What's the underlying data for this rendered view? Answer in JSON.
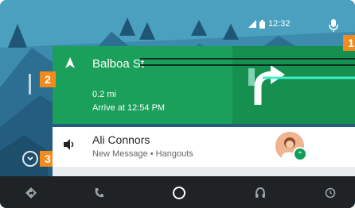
{
  "status_bar": {
    "time": "12:32"
  },
  "markers": [
    "1",
    "2",
    "3"
  ],
  "navigation": {
    "street": "Balboa St",
    "distance": "0.2 mi",
    "arrival": "Arrive at 12:54 PM"
  },
  "notification": {
    "title": "Ali Connors",
    "subtitle": "New Message • Hangouts"
  },
  "nav_bar": {
    "items": [
      "navigation-icon",
      "phone-icon",
      "home-icon",
      "headphones-icon",
      "recents-icon"
    ]
  },
  "colors": {
    "accent_green": "#1aa05a",
    "marker_orange": "#f28b1e",
    "nav_bar_bg": "#1f2326"
  }
}
